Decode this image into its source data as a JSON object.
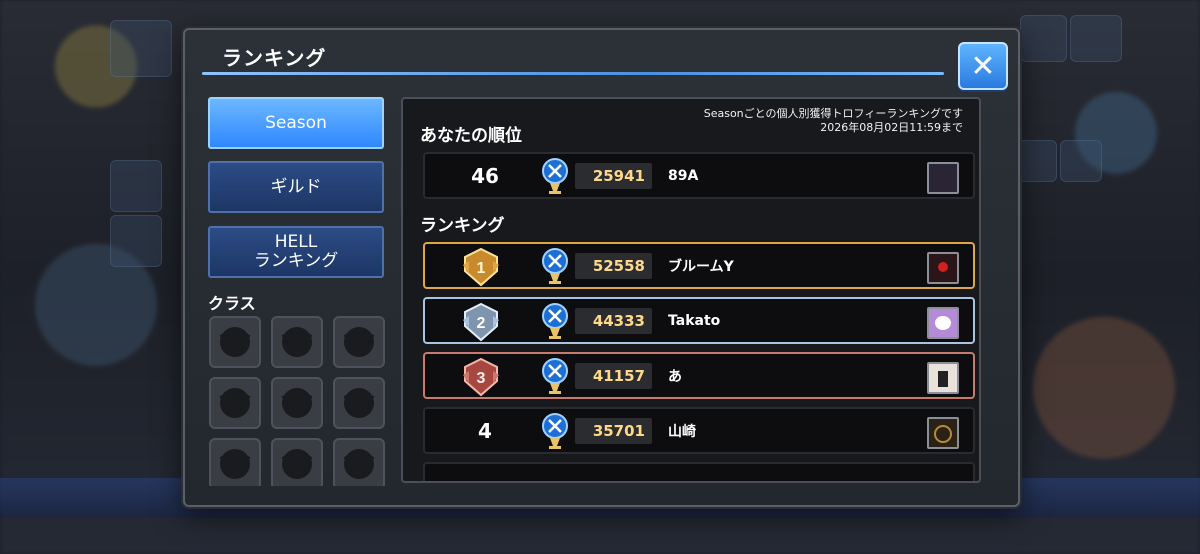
{
  "dialog": {
    "title": "ランキング",
    "close_label": "✕"
  },
  "tabs": [
    {
      "label": "Season",
      "active": true
    },
    {
      "label": "ギルド",
      "active": false
    },
    {
      "label": "HELL\nランキング",
      "active": false
    }
  ],
  "class_section": {
    "label": "クラス",
    "icons": [
      "class-icon-1",
      "class-icon-2",
      "class-icon-3",
      "class-icon-4",
      "class-icon-5",
      "class-icon-6",
      "class-icon-7",
      "class-icon-8",
      "class-icon-9"
    ]
  },
  "panel": {
    "note_line1": "Seasonごとの個人別獲得トロフィーランキングです",
    "note_line2": "2026年08月02日11:59まで",
    "my_rank_label": "あなたの順位",
    "ranking_label": "ランキング",
    "my_rank": {
      "rank": "46",
      "score": "25941",
      "name": "89A"
    },
    "rankings": [
      {
        "rank": "1",
        "score": "52558",
        "name": "ブルームY",
        "medal": "gold"
      },
      {
        "rank": "2",
        "score": "44333",
        "name": "Takato",
        "medal": "silver"
      },
      {
        "rank": "3",
        "score": "41157",
        "name": "あ",
        "medal": "bronze"
      },
      {
        "rank": "4",
        "score": "35701",
        "name": "山崎",
        "medal": "none"
      }
    ]
  },
  "colors": {
    "accent_blue": "#2f88ff",
    "gold": "#e0a544",
    "silver": "#a9c4e0",
    "bronze": "#c77a6e",
    "score_text": "#ffd98a"
  }
}
